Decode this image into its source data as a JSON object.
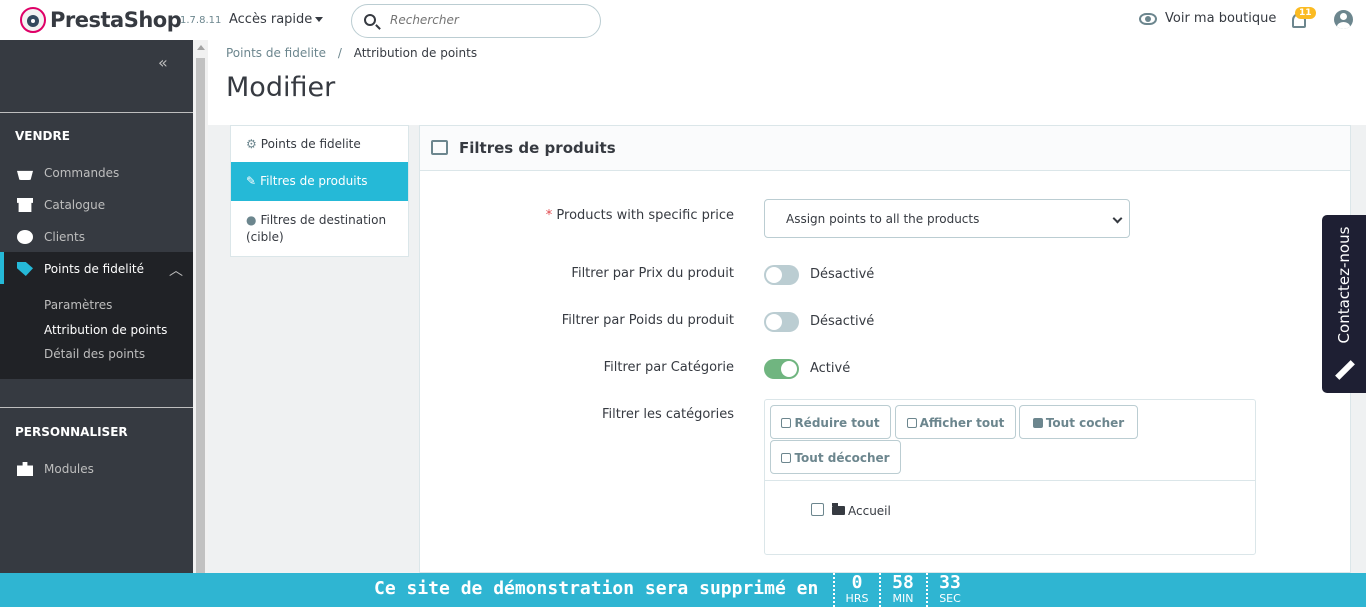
{
  "header": {
    "brand": "PrestaShop",
    "version": "1.7.8.11",
    "quick_access": "Accès rapide",
    "search_placeholder": "Rechercher",
    "view_shop": "Voir ma boutique",
    "notif_count": "11"
  },
  "sidebar": {
    "collapse": "«",
    "section_sell": "VENDRE",
    "items": [
      {
        "label": "Commandes"
      },
      {
        "label": "Catalogue"
      },
      {
        "label": "Clients"
      },
      {
        "label": "Points de fidelité"
      }
    ],
    "sub_items": [
      {
        "label": "Paramètres"
      },
      {
        "label": "Attribution de points"
      },
      {
        "label": "Détail des points"
      }
    ],
    "section_custom": "PERSONNALISER",
    "modules": "Modules"
  },
  "breadcrumb": {
    "parent": "Points de fidelite",
    "sep": "/",
    "current": "Attribution de points"
  },
  "page_title": "Modifier",
  "tabs": [
    {
      "label": "Points de fidelite"
    },
    {
      "label": "Filtres de produits"
    },
    {
      "label": "Filtres de destination (cible)"
    }
  ],
  "panel": {
    "title": "Filtres de produits",
    "fields": {
      "specific_price_label": "Products with specific price",
      "specific_price_value": "Assign points to all the products",
      "price_filter_label": "Filtrer par Prix du produit",
      "price_filter_state": "Désactivé",
      "weight_filter_label": "Filtrer par Poids du produit",
      "weight_filter_state": "Désactivé",
      "category_filter_label": "Filtrer par Catégorie",
      "category_filter_state": "Activé",
      "categories_label": "Filtrer les catégories"
    },
    "tree_buttons": {
      "collapse_all": "Réduire tout",
      "expand_all": "Afficher tout",
      "check_all": "Tout cocher",
      "uncheck_all": "Tout décocher"
    },
    "tree_root": "Accueil"
  },
  "contact_tab": "Contactez-nous",
  "demo_bar": {
    "message": "Ce site de démonstration sera supprimé en",
    "hours": "0",
    "hours_unit": "HRS",
    "minutes": "58",
    "minutes_unit": "MIN",
    "seconds": "33",
    "seconds_unit": "SEC"
  },
  "colors": {
    "accent": "#25b9d7",
    "sidebar": "#363a41",
    "switch_on": "#70b580",
    "demo_bar": "#2fb5d2"
  }
}
